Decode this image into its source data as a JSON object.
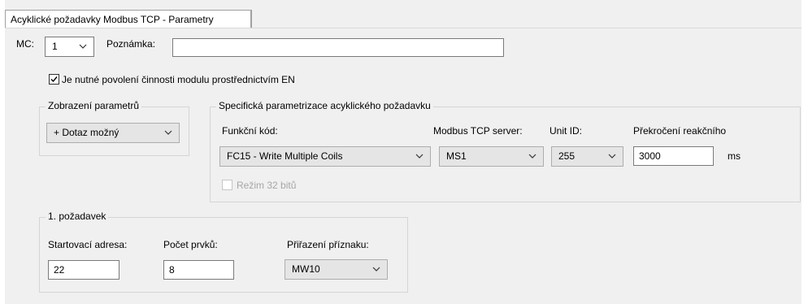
{
  "tab": {
    "label": "Acyklické požadavky Modbus TCP - Parametry"
  },
  "mc": {
    "label": "MC:",
    "value": "1"
  },
  "note": {
    "label": "Poznámka:",
    "value": ""
  },
  "enable_checkbox": {
    "label": "Je nutné povolení činnosti modulu prostřednictvím EN",
    "checked": true
  },
  "display_group": {
    "title": "Zobrazení parametrů",
    "value": "+ Dotaz možný"
  },
  "specific_group": {
    "title": "Specifická parametrizace acyklického požadavku",
    "function_code": {
      "label": "Funkční kód:",
      "value": "FC15 - Write Multiple Coils"
    },
    "server": {
      "label": "Modbus TCP server:",
      "value": "MS1"
    },
    "unit_id": {
      "label": "Unit ID:",
      "value": "255"
    },
    "timeout": {
      "label": "Překročení reakčního",
      "value": "3000",
      "unit": "ms"
    },
    "mode32": {
      "label": "Režim 32 bitů",
      "checked": false,
      "enabled": false
    }
  },
  "request_group": {
    "title": "1. požadavek",
    "start_address": {
      "label": "Startovací adresa:",
      "value": "22"
    },
    "count": {
      "label": "Počet prvků:",
      "value": "8"
    },
    "flag": {
      "label": "Přiřazení příznaku:",
      "value": "MW10"
    }
  }
}
